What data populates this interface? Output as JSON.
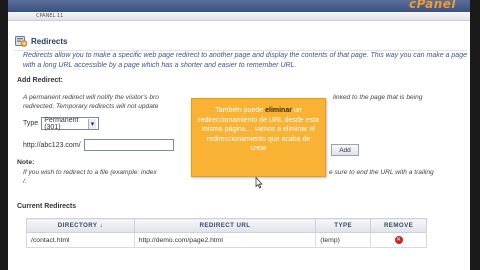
{
  "app": {
    "brand": "cPanel",
    "breadcrumb": "CPANEL 11"
  },
  "page": {
    "title": "Redirects",
    "description": "Redirects allow you to make a specific web page redirect to another page and display the contents of that page. This way you can make a page with a long URL accessible by a page which has a shorter and easier to remember URL."
  },
  "add_redirect": {
    "heading": "Add Redirect:",
    "info_line1": "A permanent redirect will notify the visitor's bro",
    "info_line1_tail": "linked to the page that is being",
    "info_line2": "redirected. Temporary redirects will not update",
    "type_label": "Type",
    "type_value": "Permanent (301)",
    "url_prefix": "http://abc123.com/",
    "url_value": "",
    "add_button": "Add"
  },
  "note": {
    "label": "Note:",
    "line1": "If you wish to redirect to a file (example: index",
    "line1_tail": "e sure to end the URL with a trailing",
    "line2": "/."
  },
  "tooltip": {
    "pre": "También puede ",
    "bold": "eliminar",
    "post": " un redireccionamiento de URL desde esta misma página… vamos a eliminar el redireccionamiento que acaba de crear"
  },
  "current": {
    "heading": "Current Redirects",
    "columns": [
      "Directory ↓",
      "Redirect Url",
      "Type",
      "Remove"
    ],
    "rows": [
      {
        "directory": "/contact.html",
        "url": "http://demo.com/page2.html",
        "type": "(temp)"
      }
    ]
  },
  "colors": {
    "brand": "#f29b2b",
    "tooltip_bg": "#f9b233",
    "remove": "#d21f1f"
  }
}
